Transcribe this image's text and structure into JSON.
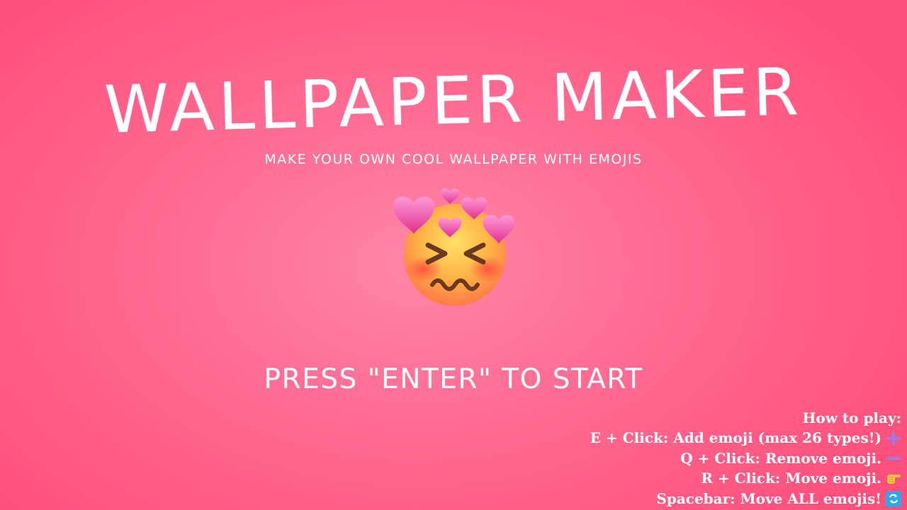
{
  "title": "WALLPAPER MAKER",
  "subtitle": "MAKE YOUR OWN COOL WALLPAPER WITH EMOJIS",
  "hero_emoji": "face-with-hearts-emoji",
  "start_prompt": "PRESS \"ENTER\" TO START",
  "how_to_play": {
    "heading": "How to play:",
    "rows": [
      {
        "text": "E + Click: Add emoji (max 26 types!)",
        "icon": "plus-icon"
      },
      {
        "text": "Q + Click: Remove emoji.",
        "icon": "minus-icon"
      },
      {
        "text": "R + Click: Move emoji.",
        "icon": "pointing-hand-icon"
      },
      {
        "text": "Spacebar: Move ALL emojis!",
        "icon": "repeat-icon"
      }
    ]
  },
  "colors": {
    "background_center": "#ff86a6",
    "background_edge": "#ff4f7c",
    "text": "#ffffff",
    "plus_minus_icon": "#9b7bf0",
    "repeat_icon": "#2ea6e8"
  }
}
